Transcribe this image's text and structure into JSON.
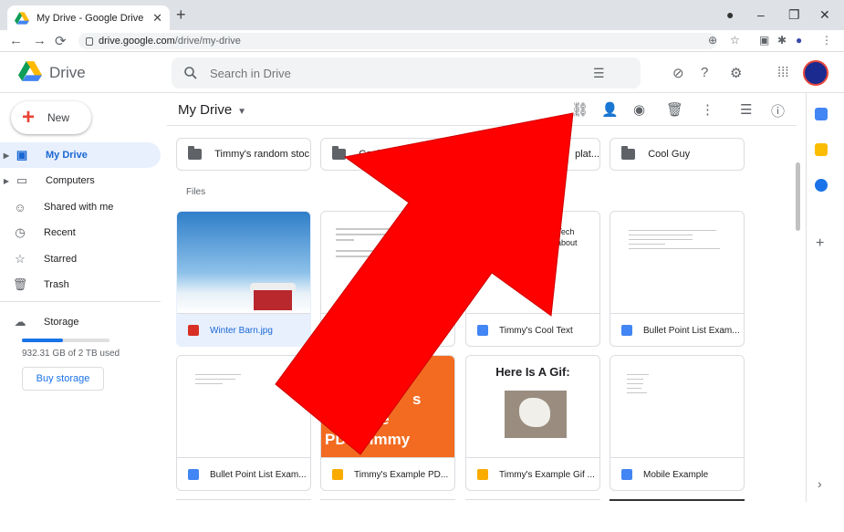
{
  "browser": {
    "tab_title": "My Drive - Google Drive",
    "tab_close": "✕",
    "new_tab": "+",
    "url_host": "drive.google.com",
    "url_path": "/drive/my-drive",
    "win_minimize": "–",
    "win_restore": "❐",
    "win_close": "✕"
  },
  "header": {
    "brand": "Drive",
    "search_placeholder": "Search in Drive"
  },
  "sidebar": {
    "new_label": "New",
    "items": [
      {
        "label": "My Drive"
      },
      {
        "label": "Computers"
      },
      {
        "label": "Shared with me"
      },
      {
        "label": "Recent"
      },
      {
        "label": "Starred"
      },
      {
        "label": "Trash"
      },
      {
        "label": "Storage"
      }
    ],
    "storage_used": "932.31 GB of 2 TB used",
    "storage_fraction": 0.47,
    "buy_storage": "Buy storage"
  },
  "main": {
    "breadcrumb": "My Drive",
    "files_label": "Files",
    "folders": [
      {
        "name": "Timmy's random stoc..."
      },
      {
        "name": "Cool Guy 2"
      },
      {
        "name": "plat..."
      },
      {
        "name": "Cool Guy"
      }
    ],
    "files": [
      {
        "name": "Winter Barn.jpg"
      },
      {
        "name": "Timmy's Cool Text"
      },
      {
        "name": "Bullet Point List Exam..."
      },
      {
        "name": "Bullet Point List Exam..."
      },
      {
        "name": "Timmy's Example PD..."
      },
      {
        "name": "Timmy's Example Gif ..."
      },
      {
        "name": "Mobile Example"
      }
    ],
    "doc_snippets": {
      "tech_lines": [
        "a Tech",
        "y about",
        "n"
      ],
      "pdf_lines": [
        "s",
        "ple",
        "PDF Timmy"
      ],
      "gif_title": "Here Is A Gif:"
    }
  },
  "colors": {
    "accent": "#1a73e8",
    "active_bg": "#e8f0fe",
    "arrow": "#ff0000",
    "pdf_orange": "#f26b21",
    "slides_yellow": "#f9ab00",
    "docs_blue": "#4285f4",
    "image_red": "#d93025"
  }
}
